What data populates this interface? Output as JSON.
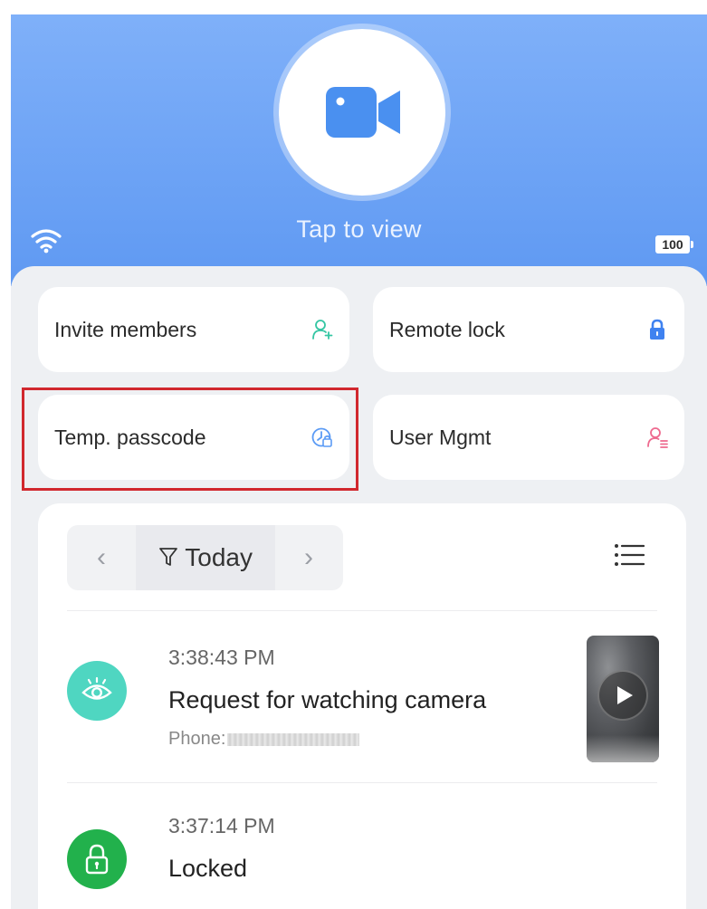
{
  "header": {
    "tap_label": "Tap to view",
    "battery_level": "100",
    "accent_color": "#6aa3f6"
  },
  "actions": [
    {
      "label": "Invite members",
      "icon": "add-user-icon",
      "color": "#34c6a3"
    },
    {
      "label": "Remote lock",
      "icon": "lock-icon",
      "color": "#3f82f0"
    },
    {
      "label": "Temp. passcode",
      "icon": "passcode-icon",
      "color": "#5b9bf5"
    },
    {
      "label": "User Mgmt",
      "icon": "user-list-icon",
      "color": "#ee6a8f"
    }
  ],
  "highlighted_action": "Temp. passcode",
  "log": {
    "filter_label": "Today",
    "prev_icon": "chevron-left-icon",
    "next_icon": "chevron-right-icon",
    "filter_icon": "filter-icon",
    "menu_icon": "list-icon",
    "events": [
      {
        "time": "3:38:43 PM",
        "title": "Request for watching camera",
        "sub_label": "Phone:",
        "icon": "eye-icon",
        "icon_color": "#4fd6c1",
        "has_video": true
      },
      {
        "time": "3:37:14 PM",
        "title": "Locked",
        "icon": "lock-icon",
        "icon_color": "#22b14c",
        "has_video": false
      }
    ]
  }
}
